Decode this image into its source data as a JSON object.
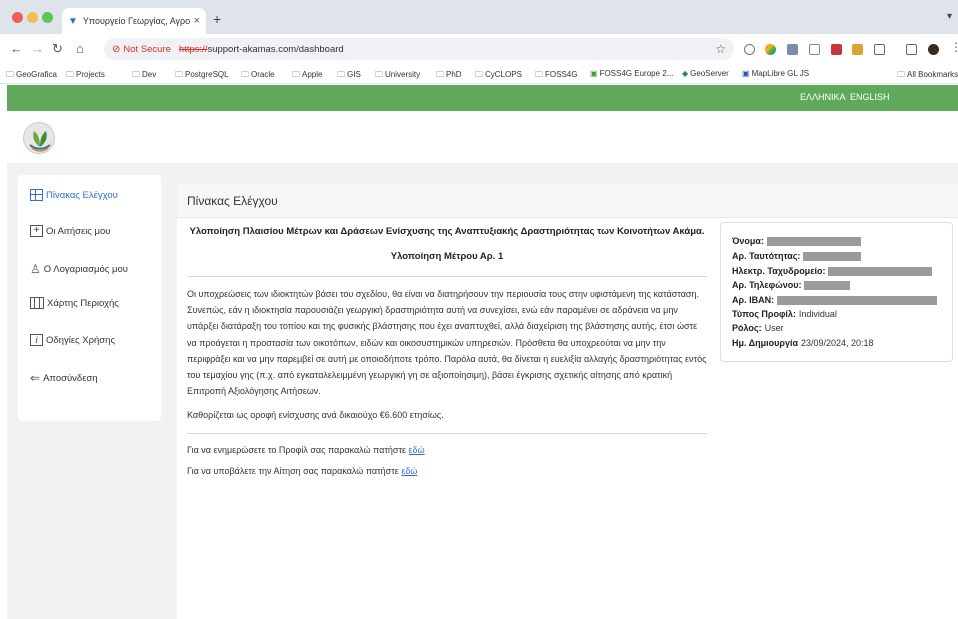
{
  "browser": {
    "tab_title": "Υπουργείο Γεωργίας, Αγροτι",
    "tab_close": "×",
    "new_tab": "+",
    "not_secure": "Not Secure",
    "url_scheme": "https://",
    "url_rest": "support-akamas.com/dashboard",
    "bookmarks": [
      "GeoGrafica",
      "Projects",
      "Dev",
      "PostgreSQL",
      "Oracle",
      "Apple",
      "GIS",
      "University",
      "PhD",
      "CyCLOPS",
      "FOSS4G",
      "FOSS4G Europe 2...",
      "GeoServer",
      "MapLibre GL JS",
      "All Bookmarks"
    ]
  },
  "header": {
    "lang_greek": "ΕΛΛΗΝΙΚΑ",
    "lang_english": "ENGLISH"
  },
  "sidebar": {
    "items": [
      {
        "label": "Πίνακας Ελέγχου",
        "icon": "dashboard-icon"
      },
      {
        "label": "Οι Αιτήσεις μου",
        "icon": "plus-square-icon"
      },
      {
        "label": "Ο Λογαριασμός μου",
        "icon": "user-icon"
      },
      {
        "label": "Χάρτης Περιοχής",
        "icon": "map-icon"
      },
      {
        "label": "Οδηγίες Χρήσης",
        "icon": "info-icon"
      },
      {
        "label": "Αποσύνδεση",
        "icon": "logout-icon"
      }
    ]
  },
  "main": {
    "title": "Πίνακας Ελέγχου",
    "heading": "Υλοποίηση Πλαισίου Μέτρων και Δράσεων Ενίσχυσης της Αναπτυξιακής Δραστηριότητας των Κοινοτήτων Ακάμα.",
    "subheading": "Υλοποίηση Μέτρου Αρ. 1",
    "paragraph": "Οι υποχρεώσεις των ιδιοκτητών βάσει του σχεδίου, θα είναι να διατηρήσουν την περιουσία τους στην υφιστάμενη της κατάσταση. Συνεπώς, εάν η ιδιοκτησία παρουσιάζει γεωργική δραστηριότητα αυτή να συνεχίσει, ενώ εάν παραμένει σε αδράνεια να μην υπάρξει διατάραξη του τοπίου και της φυσικής βλάστησης που έχει αναπτυχθεί, αλλά διαχείριση της βλάστησης αυτής, έτσι ώστε να προάγεται η προστασία των οικοτόπων, ειδών και οικοσυστημικών υπηρεσιών. Πρόσθετα θα υποχρεούται να μην την περιφράξει και να μην παρεμβεί σε αυτή με οποιοδήποτε τρόπο. Παρόλα αυτά, θα δίνεται η ευελιξία αλλαγής δραστηριότητας εντός του τεμαχίου γης (π.χ. από εγκαταλελειμμένη γεωργική γη σε αξιοποίησιμη), βάσει έγκρισης σχετικής αίτησης από κρατική Επιτροπή Αξιολόγησης Αιτήσεων.",
    "ceiling": "Καθορίζεται ως οροφή ενίσχυσης ανά δικαιούχο €6.600 ετησίως.",
    "profile_text": "Για να ενημερώσετε το Προφίλ σας παρακαλώ πατήστε",
    "profile_link": "εδώ",
    "apply_text": "Για να υποβάλετε την Αίτηση σας παρακαλώ πατήστε",
    "apply_link": "εδώ"
  },
  "profile": {
    "name_label": "Όνομα:",
    "id_label": "Αρ. Ταυτότητας:",
    "email_label": "Ηλεκτρ. Ταχυδρομείο:",
    "phone_label": "Αρ. Τηλεφώνου:",
    "iban_label": "Αρ. IBAN:",
    "type_label": "Τύπος Προφίλ:",
    "type_value": "Individual",
    "role_label": "Ρόλος:",
    "role_value": "User",
    "created_label": "Ημ. Δημιουργία",
    "created_value": "23/09/2024, 20:18"
  },
  "colors": {
    "green": "#5ea95a",
    "accent": "#2f6fd0",
    "redaction": "#9b9b9b"
  }
}
